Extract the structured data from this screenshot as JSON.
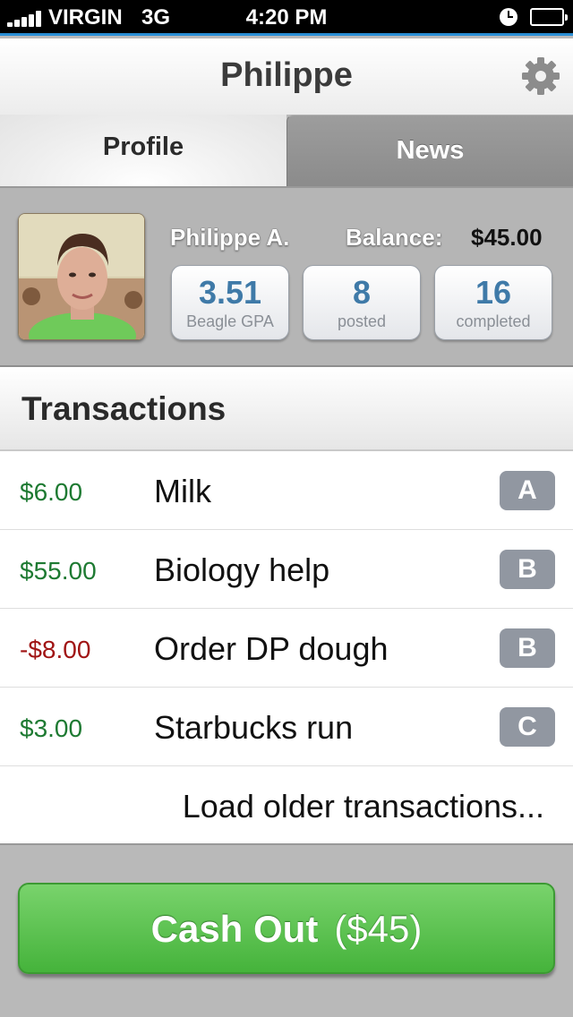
{
  "status_bar": {
    "carrier": "VIRGIN",
    "network": "3G",
    "time": "4:20 PM"
  },
  "nav": {
    "title": "Philippe",
    "settings_icon": "gear-icon"
  },
  "tabs": [
    {
      "label": "Profile",
      "selected": true
    },
    {
      "label": "News",
      "selected": false
    }
  ],
  "profile": {
    "name": "Philippe A.",
    "balance_label": "Balance:",
    "balance_value": "$45.00",
    "stats": [
      {
        "value": "3.51",
        "label": "Beagle GPA"
      },
      {
        "value": "8",
        "label": "posted"
      },
      {
        "value": "16",
        "label": "completed"
      }
    ]
  },
  "transactions": {
    "title": "Transactions",
    "rows": [
      {
        "amount": "$6.00",
        "description": "Milk",
        "grade": "A"
      },
      {
        "amount": "$55.00",
        "description": "Biology help",
        "grade": "B"
      },
      {
        "amount": "-$8.00",
        "description": "Order DP dough",
        "grade": "B"
      },
      {
        "amount": "$3.00",
        "description": "Starbucks run",
        "grade": "C"
      }
    ],
    "load_more": "Load older transactions..."
  },
  "cash_out": {
    "label": "Cash Out",
    "amount": "($45)"
  },
  "colors": {
    "positive": "#1e7a32",
    "negative": "#a01414",
    "accent": "#3f7aa8",
    "button": "#4cb841"
  }
}
